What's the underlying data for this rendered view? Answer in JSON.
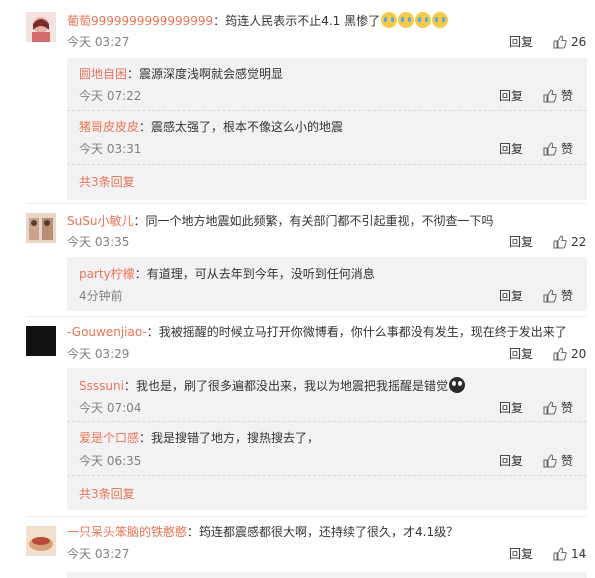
{
  "comments": [
    {
      "username": "葡萄9999999999999999",
      "separator": "：",
      "text": "筠连人民表示不止4.1  黑惨了",
      "emoji_count": 4,
      "time": "今天 03:27",
      "reply_label": "回复",
      "likes": "26",
      "avatar_color": "#e9b0a6"
    },
    {
      "username": "SuSu小敏儿",
      "separator": "：",
      "text": "同一个地方地震如此频繁，有关部门都不引起重视，不彻查一下吗",
      "time": "今天 03:35",
      "reply_label": "回复",
      "likes": "22",
      "avatar_color": "#c9a48a"
    },
    {
      "username": "-Gouwenjiao-",
      "separator": "：",
      "text": "我被摇醒的时候立马打开你微博看，你什么事都没有发生，现在终于发出来了",
      "time": "今天 03:29",
      "reply_label": "回复",
      "likes": "20",
      "avatar_color": "#111111"
    },
    {
      "username": "一只呆头笨脑的铁憨憨",
      "separator": "：",
      "text": "筠连都震感都很大啊，还持续了很久，才4.1级？",
      "time": "今天 03:27",
      "reply_label": "回复",
      "likes": "14",
      "avatar_color": "#d8a27a"
    }
  ],
  "sub_replies": {
    "group1": [
      {
        "username": "圆地自困",
        "separator": "：",
        "text": "震源深度浅啊就会感觉明显",
        "time": "今天 07:22",
        "reply_label": "回复",
        "like_label": "赞"
      },
      {
        "username": "猪哥皮皮皮",
        "separator": "：",
        "text": "震感太强了，根本不像这么小的地震",
        "time": "今天 03:31",
        "reply_label": "回复",
        "like_label": "赞"
      }
    ],
    "group1_more": "共3条回复",
    "group2": [
      {
        "username": "party柠檬",
        "separator": "：",
        "text": "有道理，可从去年到今年，没听到任何消息",
        "time": "4分钟前",
        "reply_label": "回复",
        "like_label": "赞"
      }
    ],
    "group3": [
      {
        "username": "Ssssuni",
        "separator": "：",
        "text": "我也是，刷了很多遍都没出来，我以为地震把我摇醒是错觉",
        "time": "今天 07:04",
        "reply_label": "回复",
        "like_label": "赞"
      },
      {
        "username": "爱是个口感",
        "separator": "：",
        "text": "我是搜错了地方，搜热搜去了，",
        "time": "今天 06:35",
        "reply_label": "回复",
        "like_label": "赞"
      }
    ],
    "group3_more": "共3条回复"
  },
  "colors": {
    "username": "#eb7350",
    "sub_bg": "#f2f2f5",
    "time": "#808080"
  }
}
